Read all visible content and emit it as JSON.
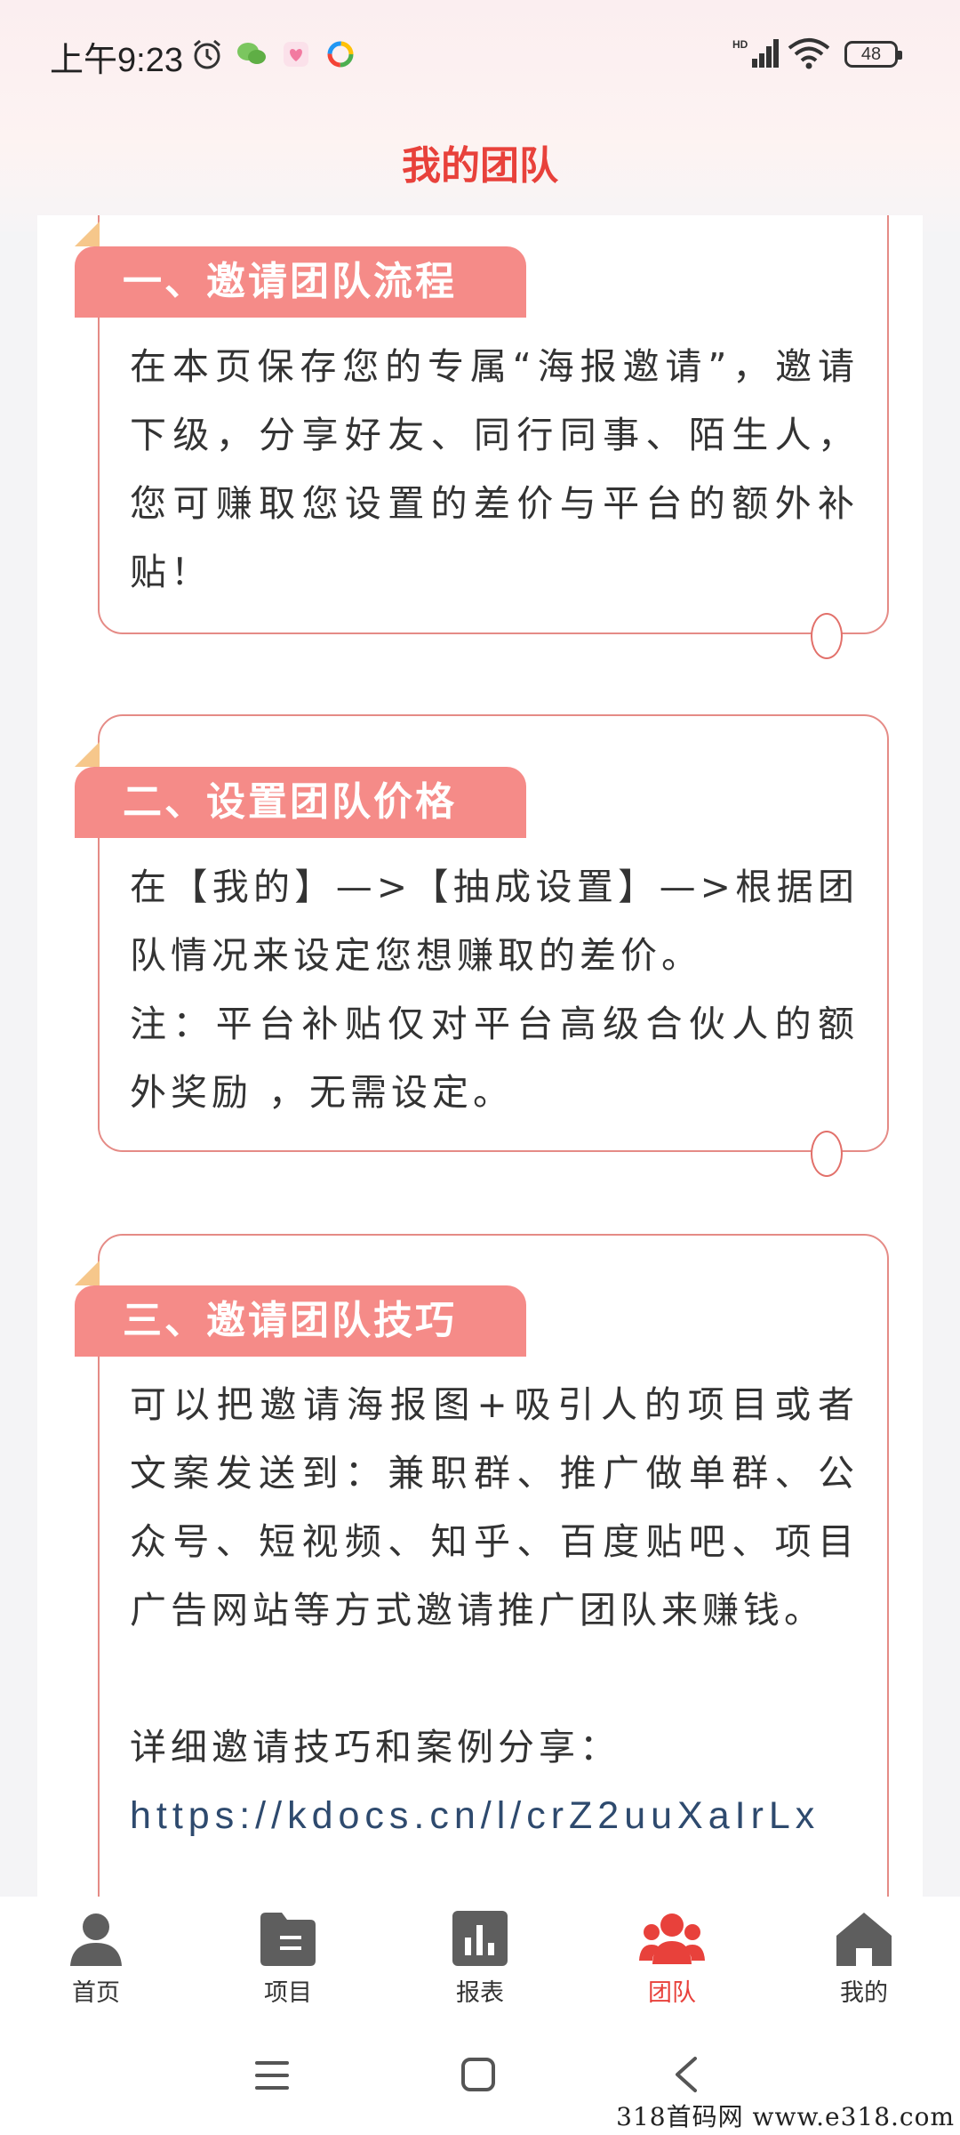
{
  "status_bar": {
    "time": "上午9:23",
    "network": "HD",
    "battery": "48"
  },
  "header": {
    "title": "我的团队"
  },
  "sections": [
    {
      "title": "一、邀请团队流程",
      "paragraphs": [
        "在本页保存您的专属“海报邀请”，邀请下级，分享好友、同行同事、陌生人，您可赚取您设置的差价与平台的额外补贴！"
      ]
    },
    {
      "title": "二、设置团队价格",
      "paragraphs": [
        "在【我的】—>【抽成设置】—>根据团队情况来设定您想赚取的差价。",
        "注：平台补贴仅对平台高级合伙人的额外奖励 ，无需设定。"
      ]
    },
    {
      "title": "三、邀请团队技巧",
      "paragraphs": [
        "可以把邀请海报图+吸引人的项目或者文案发送到：兼职群、推广做单群、公众号、短视频、知乎、百度贴吧、项目广告网站等方式邀请推广团队来赚钱。"
      ],
      "detail_label": "详细邀请技巧和案例分享：",
      "link": "https://kdocs.cn/l/crZ2uuXaIrLx"
    }
  ],
  "bottom_nav": [
    {
      "label": "首页",
      "icon": "person-icon"
    },
    {
      "label": "项目",
      "icon": "folder-icon"
    },
    {
      "label": "报表",
      "icon": "bar-chart-icon"
    },
    {
      "label": "团队",
      "icon": "team-icon",
      "active": true
    },
    {
      "label": "我的",
      "icon": "home-icon"
    }
  ],
  "colors": {
    "accent": "#e8413b",
    "header_fill": "#f58b88",
    "card_border": "#e58b86",
    "nav_icon": "#5e5e5e"
  },
  "watermark": "318首码网  www.e318.com"
}
